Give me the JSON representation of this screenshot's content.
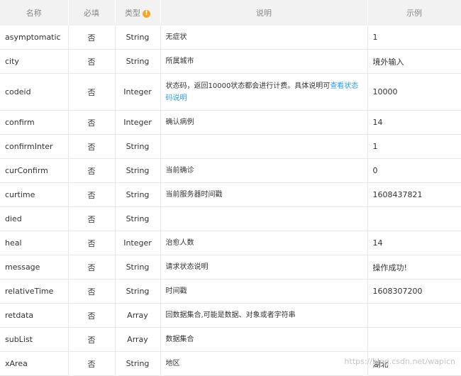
{
  "header": {
    "name": "名称",
    "required": "必填",
    "type": "类型",
    "type_icon": "warning-icon",
    "type_icon_glyph": "!",
    "description": "说明",
    "example": "示例"
  },
  "rows": [
    {
      "name": "asymptomatic",
      "required": "否",
      "type": "String",
      "desc": "无症状",
      "example": "1"
    },
    {
      "name": "city",
      "required": "否",
      "type": "String",
      "desc": "所属城市",
      "example": "境外输入"
    },
    {
      "name": "codeid",
      "required": "否",
      "type": "Integer",
      "desc": "状态码，返回10000状态都会进行计费。具体说明可",
      "desc_link": "查看状态码说明",
      "example": "10000"
    },
    {
      "name": "confirm",
      "required": "否",
      "type": "Integer",
      "desc": "确认病例",
      "example": "14"
    },
    {
      "name": "confirmInter",
      "required": "否",
      "type": "String",
      "desc": "",
      "example": "1"
    },
    {
      "name": "curConfirm",
      "required": "否",
      "type": "String",
      "desc": "当前确诊",
      "example": "0"
    },
    {
      "name": "curtime",
      "required": "否",
      "type": "String",
      "desc": "当前服务器时间戳",
      "example": "1608437821"
    },
    {
      "name": "died",
      "required": "否",
      "type": "String",
      "desc": "",
      "example": ""
    },
    {
      "name": "heal",
      "required": "否",
      "type": "Integer",
      "desc": "治愈人数",
      "example": "14"
    },
    {
      "name": "message",
      "required": "否",
      "type": "String",
      "desc": "请求状态说明",
      "example": "操作成功!"
    },
    {
      "name": "relativeTime",
      "required": "否",
      "type": "String",
      "desc": "时间戳",
      "example": "1608307200"
    },
    {
      "name": "retdata",
      "required": "否",
      "type": "Array",
      "desc": "回数据集合,可能是数据、对象或者字符串",
      "example": ""
    },
    {
      "name": "subList",
      "required": "否",
      "type": "Array",
      "desc": "数据集合",
      "example": ""
    },
    {
      "name": "xArea",
      "required": "否",
      "type": "String",
      "desc": "地区",
      "example": "湖北"
    }
  ],
  "watermark": "https://blog.csdn.net/wapicn",
  "colors": {
    "link": "#2a9ce6",
    "warning": "#f5a623",
    "header_bg": "#f2f2f2"
  }
}
